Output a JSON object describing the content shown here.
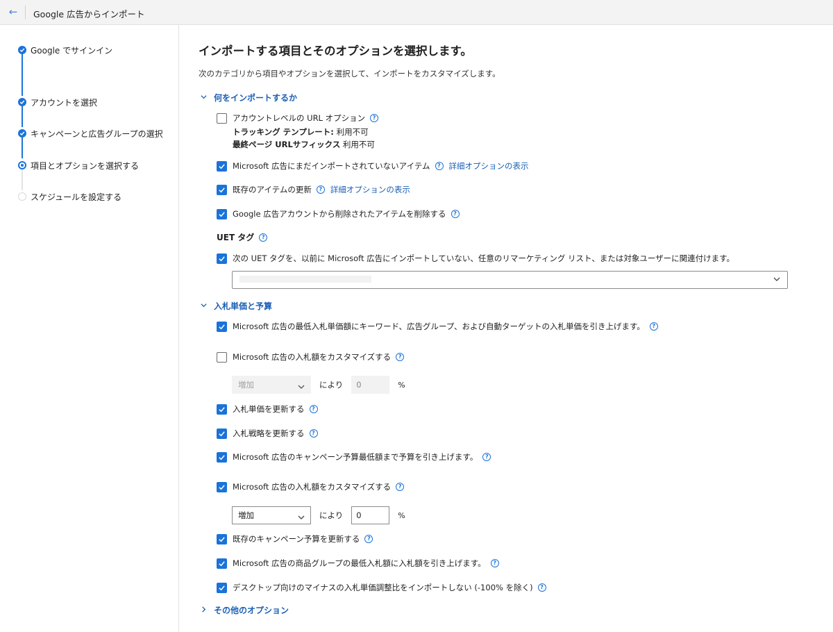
{
  "header": {
    "title": "Google 広告からインポート"
  },
  "steps": [
    {
      "label": "Google でサインイン",
      "state": "done"
    },
    {
      "label": "アカウントを選択",
      "state": "done"
    },
    {
      "label": "キャンペーンと広告グループの選択",
      "state": "done"
    },
    {
      "label": "項目とオプションを選択する",
      "state": "current"
    },
    {
      "label": "スケジュールを設定する",
      "state": "todo"
    }
  ],
  "main": {
    "title": "インポートする項目とそのオプションを選択します。",
    "description": "次のカテゴリから項目やオプションを選択して、インポートをカスタマイズします。",
    "what_section": {
      "title": "何をインポートするか",
      "account_url": {
        "label": "アカウントレベルの URL オプション",
        "checked": false,
        "tracking_label": "トラッキング テンプレート:",
        "tracking_value": "利用不可",
        "suffix_label": "最終ページ URLサフィックス",
        "suffix_value": "利用不可"
      },
      "new_items": {
        "label": "Microsoft 広告にまだインポートされていないアイテム",
        "checked": true,
        "link": "詳細オプションの表示"
      },
      "update_items": {
        "label": "既存のアイテムの更新",
        "checked": true,
        "link": "詳細オプションの表示"
      },
      "delete_items": {
        "label": "Google 広告アカウントから削除されたアイテムを削除する",
        "checked": true
      },
      "uet_heading": "UET タグ",
      "uet_assoc": {
        "label": "次の UET タグを、以前に Microsoft 広告にインポートしていない、任意のリマーケティング リスト、または対象ユーザーに関連付けます。",
        "checked": true
      }
    },
    "bid_section": {
      "title": "入札単価と予算",
      "raise_min_bids": {
        "label": "Microsoft 広告の最低入札単価額にキーワード、広告グループ、および自動ターゲットの入札単価を引き上げます。",
        "checked": true
      },
      "customize_bids_1": {
        "label": "Microsoft 広告の入札額をカスタマイズする",
        "checked": false,
        "select": "増加",
        "by": "により",
        "value": "0",
        "unit": "%"
      },
      "update_bids": {
        "label": "入札単価を更新する",
        "checked": true
      },
      "update_strategy": {
        "label": "入札戦略を更新する",
        "checked": true
      },
      "raise_budget": {
        "label": "Microsoft 広告のキャンペーン予算最低額まで予算を引き上げます。",
        "checked": true
      },
      "customize_bids_2": {
        "label": "Microsoft 広告の入札額をカスタマイズする",
        "checked": true,
        "select": "増加",
        "by": "により",
        "value": "0",
        "unit": "%"
      },
      "update_budget": {
        "label": "既存のキャンペーン予算を更新する",
        "checked": true
      },
      "raise_product_bids": {
        "label": "Microsoft 広告の商品グループの最低入札額に入札額を引き上げます。",
        "checked": true
      },
      "desktop_adjust": {
        "label": "デスクトップ向けのマイナスの入札単価調整比をインポートしない (-100% を除く)",
        "checked": true
      }
    },
    "other_section": {
      "title": "その他のオプション"
    }
  }
}
